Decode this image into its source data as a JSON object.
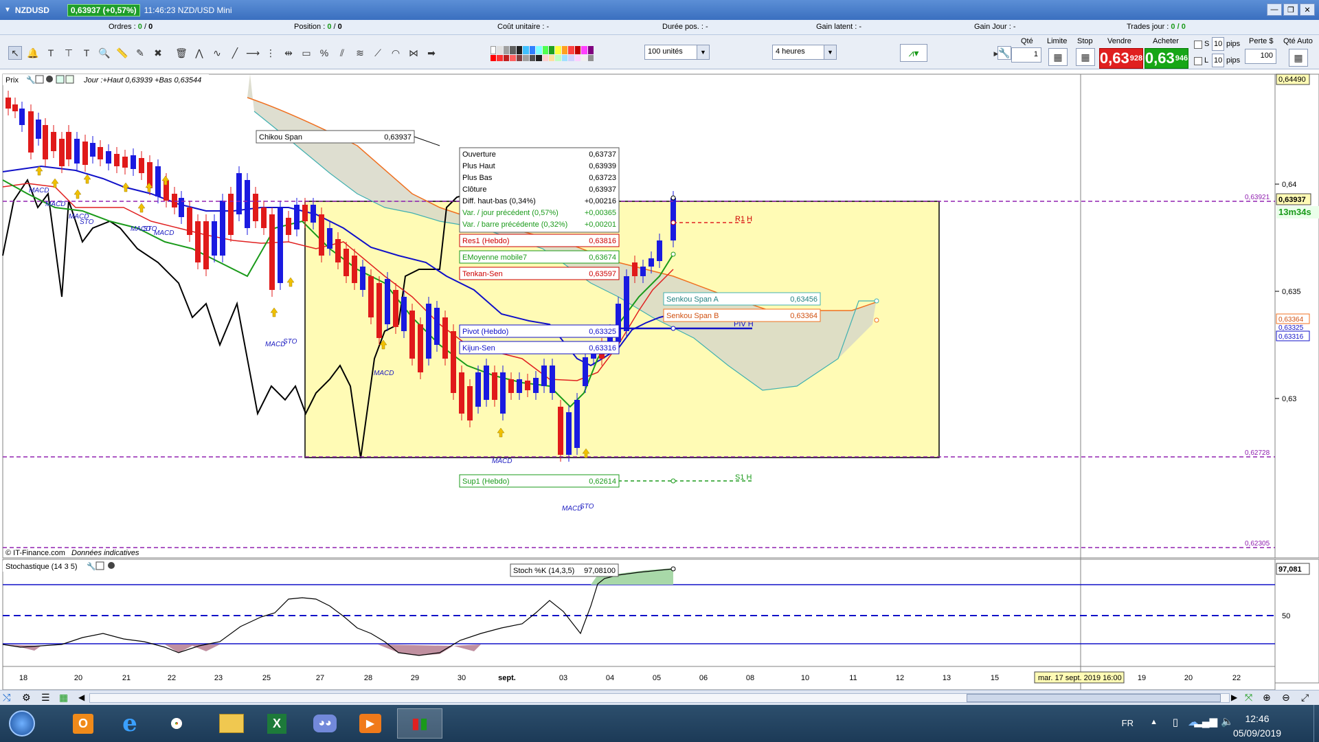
{
  "window": {
    "symbol": "NZDUSD",
    "price_badge": "0,63937 (+0,57%)",
    "title_info": "11:46:23 NZD/USD Mini"
  },
  "info_row": {
    "orders_label": "Ordres :",
    "orders_value": "0",
    "orders_sep": "/",
    "orders_value2": "0",
    "position_label": "Position :",
    "position_value": "0",
    "position_sep": "/",
    "position_value2": "0",
    "cost_label": "Coût unitaire :",
    "cost_value": "-",
    "duration_label": "Durée pos. :",
    "duration_value": "-",
    "latent_label": "Gain latent :",
    "latent_value": "-",
    "daygain_label": "Gain Jour :",
    "daygain_value": "-",
    "trades_label": "Trades jour :",
    "trades_value": "0 / 0"
  },
  "toolbar": {
    "units_select": "100 unités",
    "period_select": "4 heures",
    "qty_label": "Qté",
    "qty_value": "1",
    "limit_label": "Limite",
    "stop_label": "Stop",
    "sell_label": "Vendre",
    "sell_price_main": "0,63",
    "sell_price_sup": "928",
    "buy_label": "Acheter",
    "buy_price_main": "0,63",
    "buy_price_sup": "946",
    "s_label": "S",
    "l_label": "L",
    "pips_s_value": "10",
    "pips_l_value": "10",
    "pips_label": "pips",
    "loss_label": "Perte $",
    "loss_value": "100",
    "auto_qty_label": "Qté Auto"
  },
  "chart_panel": {
    "price_label": "Prix",
    "header_info": "Jour :+Haut 0,63939 +Bas 0,63544",
    "copyright": "© IT-Finance.com",
    "data_note": "Données indicatives",
    "stoch_label": "Stochastique (14 3 5)",
    "countdown": "13m34s",
    "crosshair_date": "mar. 17 sept. 2019 16:00"
  },
  "tooltip": {
    "rows": [
      {
        "label": "Ouverture",
        "value": "0,63737"
      },
      {
        "label": "Plus Haut",
        "value": "0,63939"
      },
      {
        "label": "Plus Bas",
        "value": "0,63723"
      },
      {
        "label": "Clôture",
        "value": "0,63937"
      },
      {
        "label": "Diff. haut-bas (0,34%)",
        "value": "+0,00216"
      },
      {
        "label": "Var. / jour précédent (0,57%)",
        "value": "+0,00365"
      },
      {
        "label": "Var. / barre précédente (0,32%)",
        "value": "+0,00201"
      }
    ]
  },
  "labels": {
    "chikou": {
      "name": "Chikou Span",
      "value": "0,63937"
    },
    "res1": {
      "name": "Res1 (Hebdo)",
      "value": "0,63816"
    },
    "ema7": {
      "name": "EMoyenne mobile7",
      "value": "0,63674"
    },
    "tenkan": {
      "name": "Tenkan-Sen",
      "value": "0,63597"
    },
    "pivot": {
      "name": "Pivot (Hebdo)",
      "value": "0,63325"
    },
    "kijun": {
      "name": "Kijun-Sen",
      "value": "0,63316"
    },
    "sup1": {
      "name": "Sup1 (Hebdo)",
      "value": "0,62614"
    },
    "ssa": {
      "name": "Senkou Span A",
      "value": "0,63456"
    },
    "ssb": {
      "name": "Senkou Span B",
      "value": "0,63364"
    },
    "stoch": {
      "name": "Stoch %K (14,3,5)",
      "value": "97,08100"
    },
    "r1h": "R1 H",
    "pivh": "PIV H",
    "s1h": "S1 H"
  },
  "price_axis": {
    "ticks": [
      "0,64490",
      "0,64",
      "0,63921",
      "0,63937",
      "0,635",
      "0,63364",
      "0,63325",
      "0,63316",
      "0,63",
      "0,62728",
      "0,62305"
    ],
    "stoch_ticks": [
      "97,081",
      "50"
    ]
  },
  "time_axis": [
    "18",
    "20",
    "21",
    "22",
    "23",
    "25",
    "27",
    "28",
    "29",
    "30",
    "sept.",
    "03",
    "04",
    "05",
    "06",
    "08",
    "10",
    "11",
    "12",
    "13",
    "15",
    "19",
    "20",
    "22"
  ],
  "annotations": {
    "macd": "MACD",
    "sto": "STO"
  },
  "taskbar": {
    "lang": "FR",
    "time": "12:46",
    "date": "05/09/2019"
  },
  "colors": {
    "bull_candle": "#1a1ae0",
    "bear_candle": "#e01a1a",
    "box_fill": "#fffbb5",
    "cloud": "#d8d8b0",
    "kijun": "#1010c8",
    "tenkan": "#e02020",
    "ema": "#1a9a1a",
    "ssb": "#f07020",
    "ssa": "#40b0b0"
  }
}
